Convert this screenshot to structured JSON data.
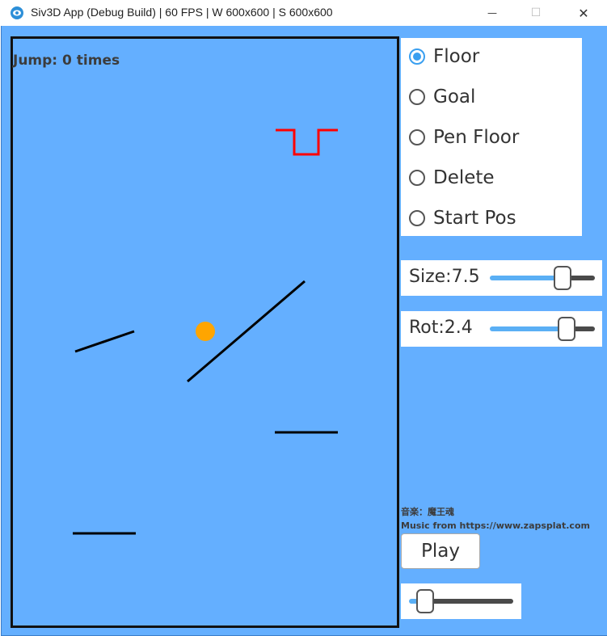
{
  "window": {
    "title": "Siv3D App (Debug Build) | 60 FPS | W 600x600 | S 600x600",
    "minimize_glyph": "—",
    "maximize_glyph": "☐",
    "close_glyph": "✕"
  },
  "game": {
    "jump_text": "Jump: 0 times",
    "colors": {
      "background": "#64afff",
      "ball": "#ffa500",
      "goal": "#ff0000",
      "floor": "#000000"
    }
  },
  "tools": {
    "options": [
      {
        "label": "Floor",
        "selected": true
      },
      {
        "label": "Goal",
        "selected": false
      },
      {
        "label": "Pen Floor",
        "selected": false
      },
      {
        "label": "Delete",
        "selected": false
      },
      {
        "label": "Start Pos",
        "selected": false
      }
    ]
  },
  "size_slider": {
    "label": "Size:7.5",
    "value": 0.68
  },
  "rot_slider": {
    "label": "Rot:2.4",
    "value": 0.69
  },
  "credits": {
    "music_jp": "音楽：魔王魂",
    "music_en": "Music from https://www.zapsplat.com"
  },
  "play_button": {
    "label": "Play"
  },
  "volume_slider": {
    "value": 0.12
  }
}
